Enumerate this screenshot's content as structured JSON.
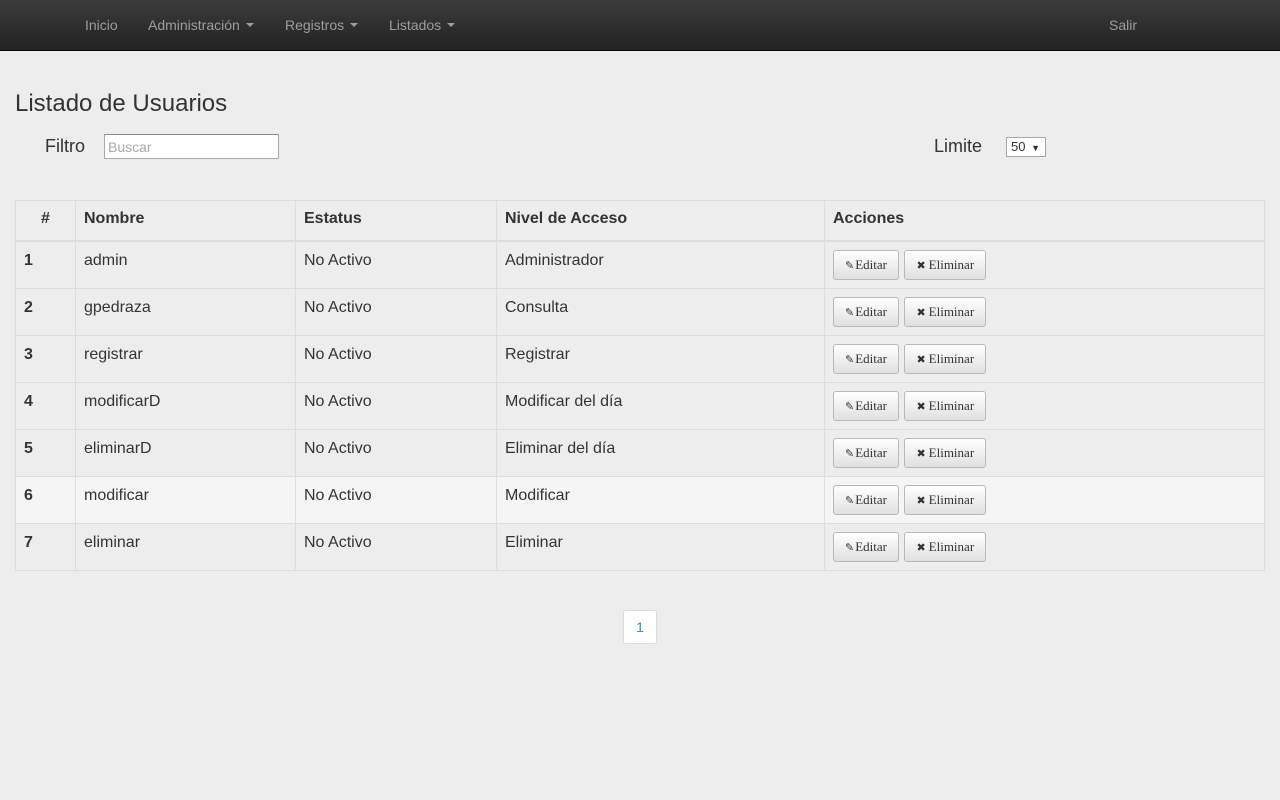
{
  "navbar": {
    "items": [
      {
        "label": "Inicio",
        "dropdown": false
      },
      {
        "label": "Administración",
        "dropdown": true
      },
      {
        "label": "Registros",
        "dropdown": true
      },
      {
        "label": "Listados",
        "dropdown": true
      }
    ],
    "logout_label": "Salir"
  },
  "page": {
    "title": "Listado de Usuarios"
  },
  "filter": {
    "label": "Filtro",
    "placeholder": "Buscar",
    "value": ""
  },
  "limit": {
    "label": "Limite",
    "selected": "50"
  },
  "table": {
    "headers": [
      "#",
      "Nombre",
      "Estatus",
      "Nivel de Acceso",
      "Acciones"
    ],
    "edit_label": "Editar",
    "delete_label": "Eliminar",
    "rows": [
      {
        "num": "1",
        "name": "admin",
        "status": "No Activo",
        "level": "Administrador"
      },
      {
        "num": "2",
        "name": "gpedraza",
        "status": "No Activo",
        "level": "Consulta"
      },
      {
        "num": "3",
        "name": "registrar",
        "status": "No Activo",
        "level": "Registrar"
      },
      {
        "num": "4",
        "name": "modificarD",
        "status": "No Activo",
        "level": "Modificar del día"
      },
      {
        "num": "5",
        "name": "eliminarD",
        "status": "No Activo",
        "level": "Eliminar del día"
      },
      {
        "num": "6",
        "name": "modificar",
        "status": "No Activo",
        "level": "Modificar"
      },
      {
        "num": "7",
        "name": "eliminar",
        "status": "No Activo",
        "level": "Eliminar"
      }
    ]
  },
  "pagination": {
    "pages": [
      "1"
    ]
  },
  "icons": {
    "edit": "edit-icon",
    "delete": "remove-icon"
  },
  "colors": {
    "navbar_bg": "#222222",
    "nav_text": "#9d9d9d",
    "link": "#428bca",
    "page_bg": "#ededed"
  }
}
